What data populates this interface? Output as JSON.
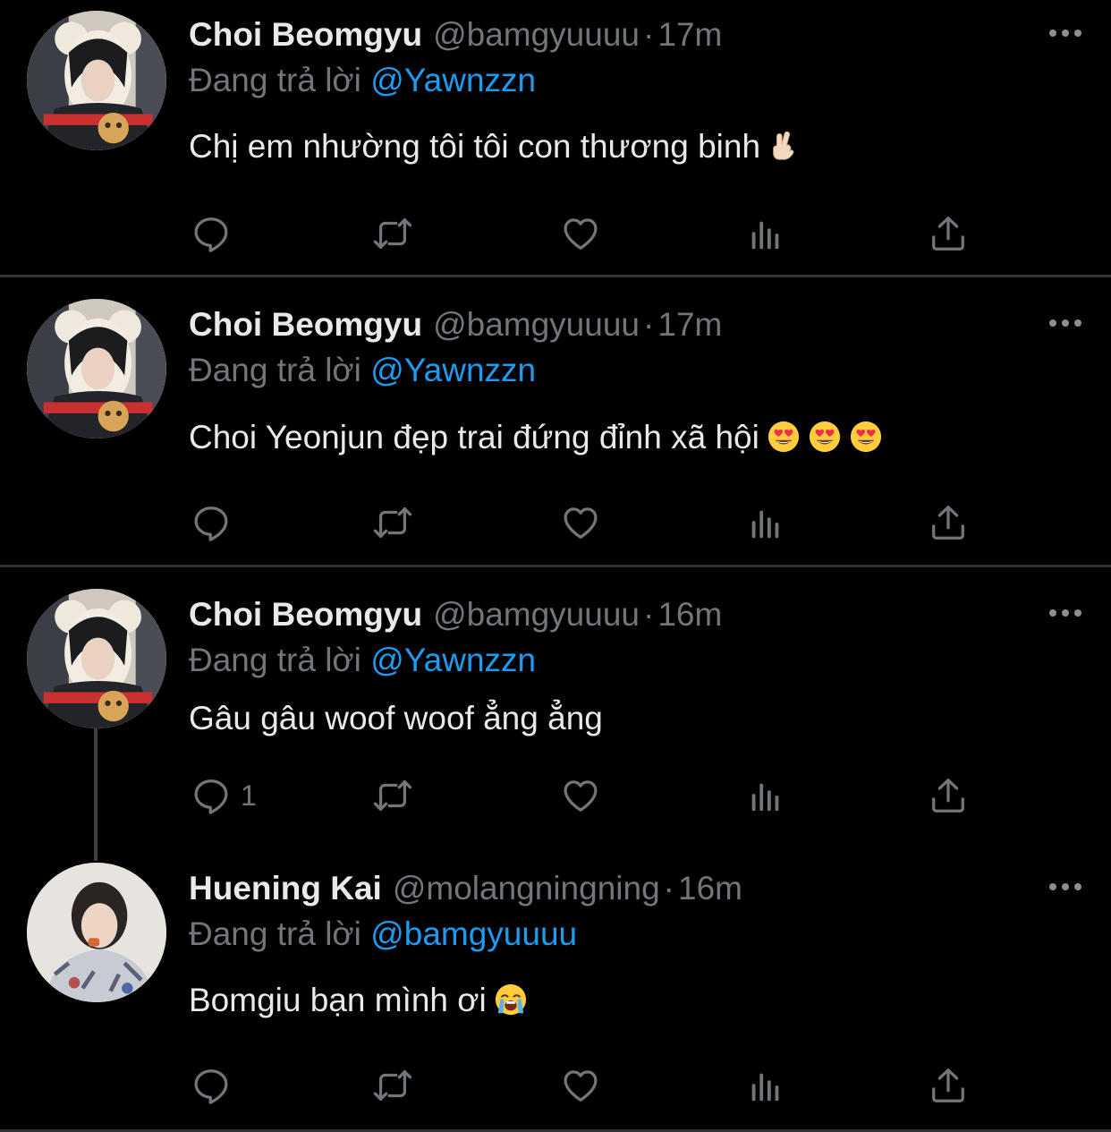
{
  "tweets": [
    {
      "name": "Choi Beomgyu",
      "handle": "@bamgyuuuu",
      "time": "17m",
      "reply_prefix": "Đang trả lời",
      "reply_to": "@Yawnzzn",
      "text": "Chị em nhường tôi tôi con thương binh",
      "emojis": [
        "crossed-fingers"
      ],
      "reply_count": ""
    },
    {
      "name": "Choi Beomgyu",
      "handle": "@bamgyuuuu",
      "time": "17m",
      "reply_prefix": "Đang trả lời",
      "reply_to": "@Yawnzzn",
      "text": "Choi Yeonjun đẹp trai đứng đỉnh xã hội",
      "emojis": [
        "heart-eyes",
        "heart-eyes",
        "heart-eyes"
      ],
      "reply_count": ""
    },
    {
      "name": "Choi Beomgyu",
      "handle": "@bamgyuuuu",
      "time": "16m",
      "reply_prefix": "Đang trả lời",
      "reply_to": "@Yawnzzn",
      "text": "Gâu gâu woof woof ẳng ẳng",
      "emojis": [],
      "reply_count": "1"
    },
    {
      "name": "Huening Kai",
      "handle": "@molangningning",
      "time": "16m",
      "reply_prefix": "Đang trả lời",
      "reply_to": "@bamgyuuuu",
      "text": "Bomgiu bạn mình ơi",
      "emojis": [
        "loudly-crying"
      ],
      "reply_count": ""
    }
  ],
  "colors": {
    "background": "#000000",
    "text": "#e7e9ea",
    "muted": "#71767b",
    "mention": "#1d9bf0",
    "divider": "#2f3336"
  },
  "icons": [
    "reply-icon",
    "retweet-icon",
    "like-icon",
    "analytics-icon",
    "share-icon",
    "more-icon"
  ]
}
